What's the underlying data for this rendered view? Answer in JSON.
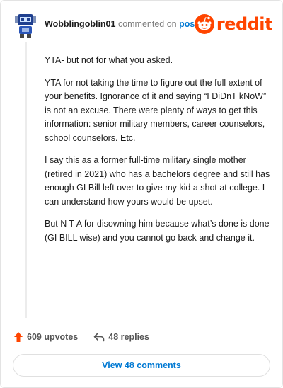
{
  "header": {
    "author": "Wobblingoblin01",
    "action_text": "commented on",
    "post_link": "post",
    "brand": "reddit"
  },
  "comment": {
    "paragraphs": [
      "YTA- but not for what you asked.",
      "YTA for not taking the time to figure out the full extent of your benefits. Ignorance of it and saying “I DiDnT kNoW” is not an excuse. There were plenty of ways to get this information: senior military members, career counselors, school counselors. Etc.",
      "I say this as a former full-time military single mother (retired in 2021) who has a bachelors degree and still has enough GI Bill left over to give my kid a shot at college. I can understand how yours would be upset.",
      "But N T A for disowning him because what’s done is done (GI BILL wise) and you cannot go back and change it."
    ]
  },
  "actions": {
    "upvotes": "609 upvotes",
    "replies": "48 replies"
  },
  "view_comments_label": "View 48 comments",
  "colors": {
    "brand": "#ff4500",
    "link": "#0079d3",
    "upvote": "#ff4500",
    "avatar_primary": "#1f3f8f"
  },
  "icons": {
    "avatar": "robot-avatar-icon",
    "brand": "reddit-alien-icon",
    "upvote": "upvote-arrow-icon",
    "reply": "reply-arrow-icon"
  }
}
